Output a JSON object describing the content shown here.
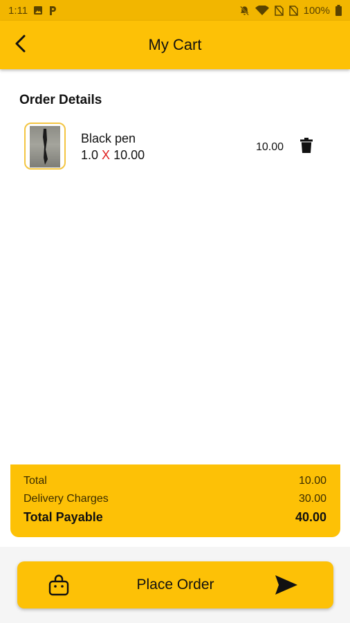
{
  "status_bar": {
    "time": "1:11",
    "battery": "100%",
    "icons": [
      "image-icon",
      "p-icon",
      "bell-off-icon",
      "wifi-icon",
      "no-sim-icon",
      "no-sim-icon",
      "battery-icon"
    ]
  },
  "app_bar": {
    "title": "My Cart",
    "back_icon": "back-arrow-icon"
  },
  "order": {
    "section_title": "Order Details",
    "items": [
      {
        "name": "Black pen",
        "quantity": "1.0",
        "times": "X",
        "unit_price": "10.00",
        "line_total": "10.00",
        "delete_icon": "trash-icon"
      }
    ]
  },
  "summary": {
    "total_label": "Total",
    "total_value": "10.00",
    "delivery_label": "Delivery Charges",
    "delivery_value": "30.00",
    "payable_label": "Total Payable",
    "payable_value": "40.00"
  },
  "place_order": {
    "label": "Place Order",
    "left_icon": "shopping-bag-icon",
    "right_icon": "send-icon"
  },
  "colors": {
    "accent": "#fdc106",
    "status_bar": "#f2b600",
    "multiply_sign": "#e02020",
    "thumb_border": "#f3c542"
  }
}
